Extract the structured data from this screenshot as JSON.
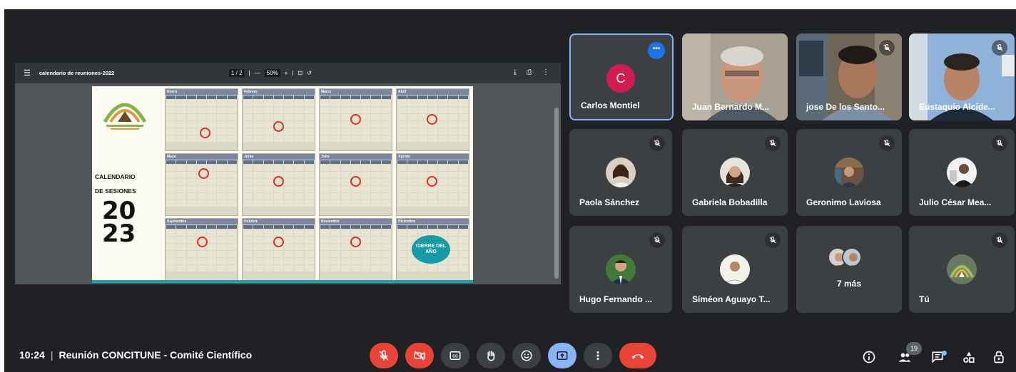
{
  "meeting": {
    "time": "10:24",
    "title": "Reunión CONCITUNE - Comité Científico",
    "participant_count": "19"
  },
  "presentation": {
    "file_name": "calendario de reuniones-2022",
    "page_indicator": "1 / 2",
    "zoom": "50%",
    "calendar_title_line1": "CALENDARIO",
    "calendar_title_line2": "DE SESIONES",
    "year_top": "20",
    "year_bottom": "23",
    "closing_badge": "CIERRE DEL AÑO",
    "months": [
      "Enero",
      "Febrero",
      "Marzo",
      "Abril",
      "Mayo",
      "Junio",
      "Julio",
      "Agosto",
      "Septiembre",
      "Octubre",
      "Noviembre",
      "Diciembre"
    ]
  },
  "participants": [
    {
      "name": "Carlos Montiel",
      "initial": "C",
      "muted": false,
      "avatar_color": "#d01c50"
    },
    {
      "name": "Juan Bernardo M...",
      "muted": false
    },
    {
      "name": "jose De los Santo...",
      "muted": true
    },
    {
      "name": "Eustaquio Alcide...",
      "muted": true
    },
    {
      "name": "Paola Sánchez",
      "muted": true
    },
    {
      "name": "Gabriela Bobadilla",
      "muted": true
    },
    {
      "name": "Geronimo Laviosa",
      "muted": true
    },
    {
      "name": "Julio César Mea...",
      "muted": true
    },
    {
      "name": "Hugo Fernando ...",
      "muted": true
    },
    {
      "name": "Síméon Aguayo T...",
      "muted": true
    },
    {
      "name": "7 más"
    },
    {
      "name": "Tú",
      "muted": true
    }
  ],
  "controls": {
    "mic_color": "#ea4335",
    "camera_color": "#ea4335",
    "present_color": "#8ab4f8",
    "leave_color": "#ea4335",
    "button_color": "#3c4043"
  }
}
